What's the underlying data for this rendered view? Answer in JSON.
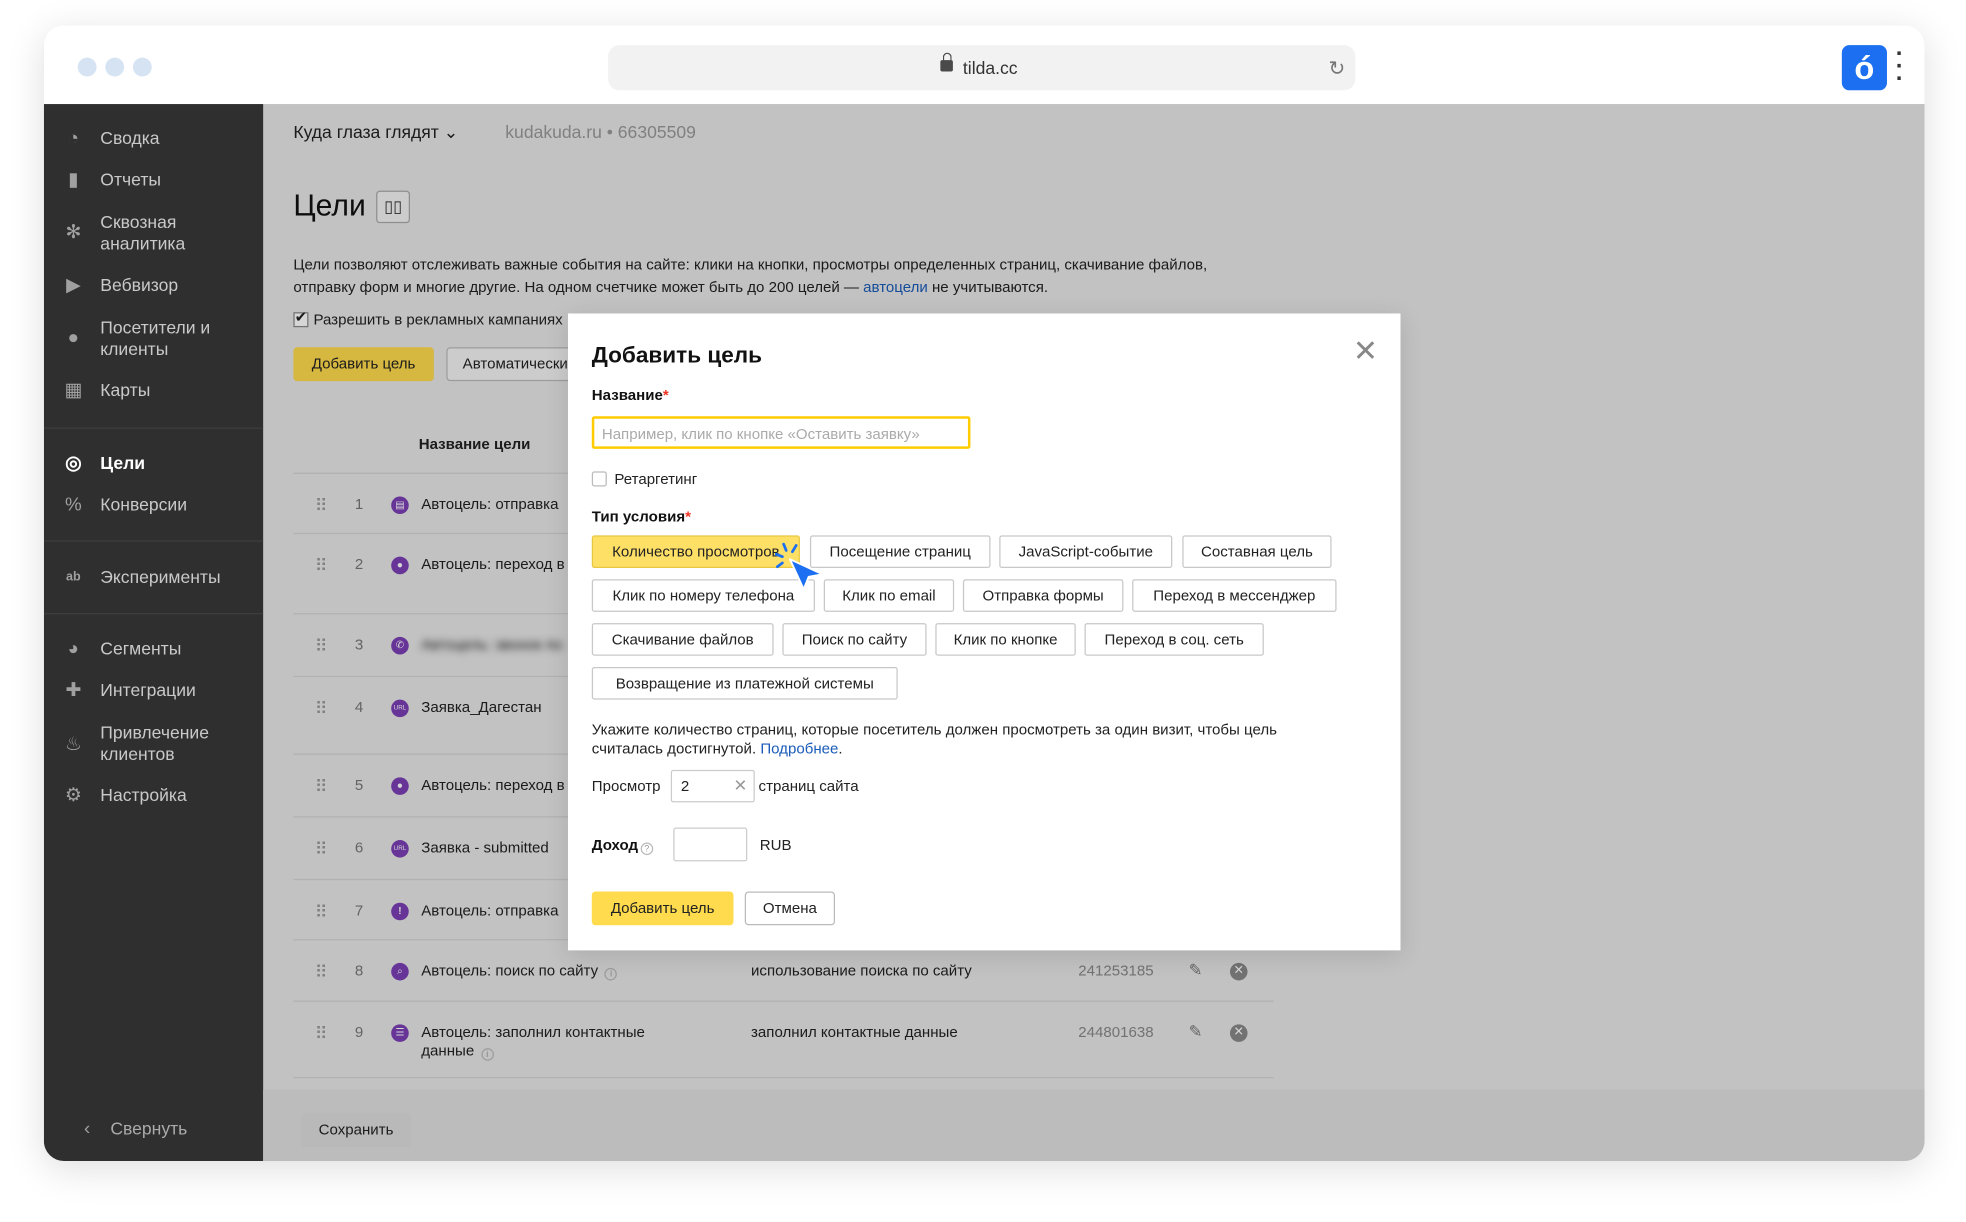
{
  "browser": {
    "url": "tilda.cc",
    "brand_letter": "ó"
  },
  "sidebar": {
    "items": [
      {
        "label": "Сводка",
        "icon": "dashboard-icon"
      },
      {
        "label": "Отчеты",
        "icon": "bar-chart-icon"
      },
      {
        "label": "Сквозная аналитика",
        "icon": "snowflake-icon"
      },
      {
        "label": "Вебвизор",
        "icon": "play-icon"
      },
      {
        "label": "Посетители и клиенты",
        "icon": "person-icon"
      },
      {
        "label": "Карты",
        "icon": "map-icon"
      },
      {
        "label": "Цели",
        "icon": "target-icon",
        "active": true
      },
      {
        "label": "Конверсии",
        "icon": "percent-icon"
      },
      {
        "label": "Эксперименты",
        "icon": "ab-icon"
      },
      {
        "label": "Сегменты",
        "icon": "pie-icon"
      },
      {
        "label": "Интеграции",
        "icon": "puzzle-icon"
      },
      {
        "label": "Привлечение клиентов",
        "icon": "flame-icon"
      },
      {
        "label": "Настройка",
        "icon": "gear-icon"
      }
    ],
    "collapse_label": "Свернуть"
  },
  "header": {
    "counter_name": "Куда глаза глядят",
    "counter_site": "kudakuda.ru • 66305509"
  },
  "page": {
    "title": "Цели",
    "description_1": "Цели позволяют отслеживать важные события на сайте: клики на кнопки, просмотры определенных страниц, скачивание файлов, отправку форм и многие другие. На одном счетчике может быть до 200 целей — ",
    "description_link": "автоцели",
    "description_2": " не учитываются.",
    "allow_ads_label": "Разрешить в рекламных кампаниях",
    "add_goal_label": "Добавить цель",
    "auto_goals_label": "Автоматически",
    "col_goal_name": "Название цели",
    "save_label": "Сохранить"
  },
  "goals": [
    {
      "n": "1",
      "name": "Автоцель: отправка",
      "cond": "",
      "id": "",
      "icon": "document-icon"
    },
    {
      "n": "2",
      "name": "Автоцель: переход в",
      "cond": "",
      "id": "",
      "icon": "chat-icon"
    },
    {
      "n": "3",
      "name": "Автоцель: звонок по",
      "cond": "",
      "id": "",
      "icon": "phone-icon",
      "blurred": true
    },
    {
      "n": "4",
      "name": "Заявка_Дагестан",
      "cond": "",
      "id": "",
      "icon": "url-icon"
    },
    {
      "n": "5",
      "name": "Автоцель: переход в",
      "cond": "",
      "id": "",
      "icon": "user-icon"
    },
    {
      "n": "6",
      "name": "Заявка - submitted",
      "cond": "",
      "id": "",
      "icon": "url-icon"
    },
    {
      "n": "7",
      "name": "Автоцель: отправка",
      "cond": "",
      "id": "",
      "icon": "alert-icon"
    },
    {
      "n": "8",
      "name": "Автоцель: поиск по сайту",
      "cond": "использование поиска по сайту",
      "id": "241253185",
      "icon": "search-icon"
    },
    {
      "n": "9",
      "name": "Автоцель: заполнил контактные данные",
      "cond": "заполнил контактные данные",
      "id": "244801638",
      "icon": "contact-icon"
    }
  ],
  "modal": {
    "title": "Добавить цель",
    "name_label": "Название",
    "name_placeholder": "Например, клик по кнопке «Оставить заявку»",
    "retargeting_label": "Ретаргетинг",
    "condition_label": "Тип условия",
    "condition_types": [
      "Количество просмотров",
      "Посещение страниц",
      "JavaScript-событие",
      "Составная цель",
      "Клик по номеру телефона",
      "Клик по email",
      "Отправка формы",
      "Переход в мессенджер",
      "Скачивание файлов",
      "Поиск по сайту",
      "Клик по кнопке",
      "Переход в соц. сеть",
      "Возвращение из платежной системы"
    ],
    "selected_condition": "Количество просмотров",
    "hint": "Укажите количество страниц, которые посетитель должен просмотреть за один визит, чтобы цель считалась достигнутой.",
    "hint_link": "Подробнее",
    "views_prefix": "Просмотр",
    "views_value": "2",
    "views_suffix": "страниц сайта",
    "income_label": "Доход",
    "currency": "RUB",
    "submit_label": "Добавить цель",
    "cancel_label": "Отмена"
  },
  "colors": {
    "accent": "#ffdb4d",
    "selected": "#ffe066",
    "link": "#1a5bb8",
    "sidebar": "#2f2f2f",
    "brand": "#1b6ff0",
    "cursor": "#1b6ff0"
  }
}
